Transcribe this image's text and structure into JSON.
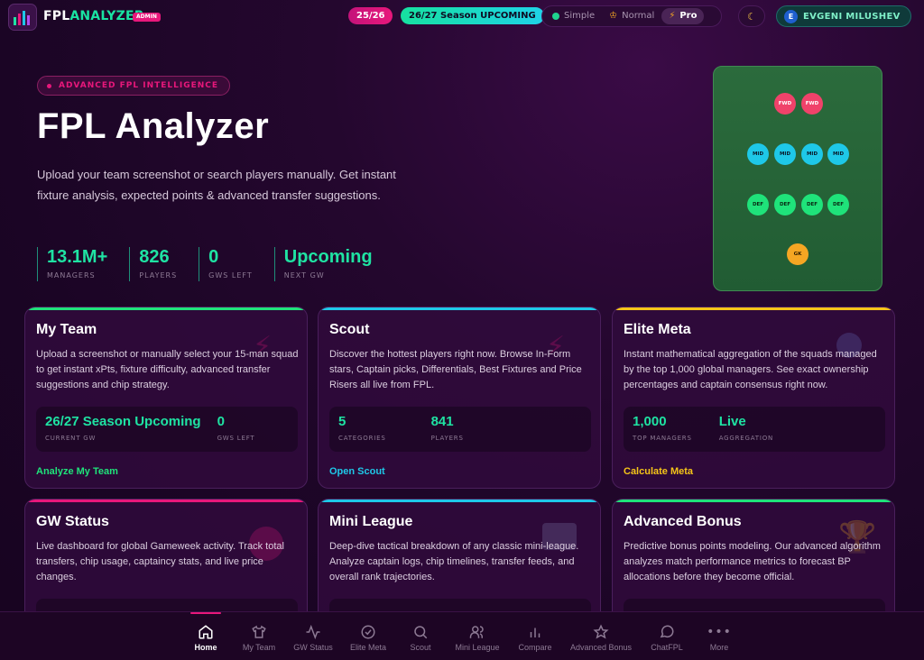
{
  "header": {
    "logo_part1": "FPL",
    "logo_part2": "ANALYZER",
    "admin_badge": "ADMIN",
    "season_pill": "25/26",
    "upcoming_pill": "26/27 Season  UPCOMING",
    "modes": [
      {
        "label": "Simple",
        "icon": "green-dot-icon"
      },
      {
        "label": "Normal",
        "icon": "crown-icon"
      },
      {
        "label": "Pro",
        "icon": "bolt-icon",
        "active": true
      }
    ],
    "theme_icon": "moon-icon",
    "user_initial": "E",
    "user_name": "EVGENI MILUSHEV"
  },
  "hero": {
    "badge": "ADVANCED FPL INTELLIGENCE",
    "title": "FPL Analyzer",
    "description": "Upload your team screenshot or search players manually. Get instant fixture analysis, expected points & advanced transfer suggestions.",
    "stats": [
      {
        "value": "13.1M+",
        "label": "MANAGERS"
      },
      {
        "value": "826",
        "label": "PLAYERS"
      },
      {
        "value": "0",
        "label": "GWS LEFT"
      },
      {
        "value": "Upcoming",
        "label": "NEXT GW"
      }
    ]
  },
  "pitch": {
    "fwd": [
      "FWD",
      "FWD"
    ],
    "mid": [
      "MID",
      "MID",
      "MID",
      "MID"
    ],
    "def": [
      "DEF",
      "DEF",
      "DEF",
      "DEF"
    ],
    "gk": [
      "GK"
    ]
  },
  "cards": [
    {
      "title": "My Team",
      "description": "Upload a screenshot or manually select your 15-man squad to get instant xPts, fixture difficulty, advanced transfer suggestions and chip strategy.",
      "stats": [
        {
          "value": "26/27 Season Upcoming",
          "label": "CURRENT GW"
        },
        {
          "value": "0",
          "label": "GWS LEFT"
        }
      ],
      "link": "Analyze My Team",
      "accent": "#1fe37a"
    },
    {
      "title": "Scout",
      "description": "Discover the hottest players right now. Browse In-Form stars, Captain picks, Differentials, Best Fixtures and Price Risers all live from FPL.",
      "stats": [
        {
          "value": "5",
          "label": "CATEGORIES"
        },
        {
          "value": "841",
          "label": "PLAYERS"
        }
      ],
      "link": "Open Scout",
      "accent": "#1ec8e8"
    },
    {
      "title": "Elite Meta",
      "description": "Instant mathematical aggregation of the squads managed by the top 1,000 global managers. See exact ownership percentages and captain consensus right now.",
      "stats": [
        {
          "value": "1,000",
          "label": "TOP MANAGERS"
        },
        {
          "value": "Live",
          "label": "AGGREGATION"
        }
      ],
      "link": "Calculate Meta",
      "accent": "#f5c518"
    },
    {
      "title": "GW Status",
      "description": "Live dashboard for global Gameweek activity. Track total transfers, chip usage, captaincy stats, and live price changes.",
      "accent": "#e8177b"
    },
    {
      "title": "Mini League",
      "description": "Deep-dive tactical breakdown of any classic mini-league. Analyze captain logs, chip timelines, transfer feeds, and overall rank trajectories.",
      "accent": "#1ec8e8"
    },
    {
      "title": "Advanced Bonus",
      "description": "Predictive bonus points modeling. Our advanced algorithm analyzes match performance metrics to forecast BP allocations before they become official.",
      "accent": "#1fe37a"
    }
  ],
  "bottom_nav": [
    {
      "label": "Home",
      "icon": "home-icon",
      "active": true
    },
    {
      "label": "My Team",
      "icon": "shirt-icon"
    },
    {
      "label": "GW Status",
      "icon": "activity-icon"
    },
    {
      "label": "Elite Meta",
      "icon": "check-circle-icon"
    },
    {
      "label": "Scout",
      "icon": "search-icon"
    },
    {
      "label": "Mini League",
      "icon": "users-icon"
    },
    {
      "label": "Compare",
      "icon": "bar-chart-icon"
    },
    {
      "label": "Advanced Bonus",
      "icon": "star-icon"
    },
    {
      "label": "ChatFPL",
      "icon": "chat-icon"
    },
    {
      "label": "More",
      "icon": "more-icon"
    }
  ]
}
